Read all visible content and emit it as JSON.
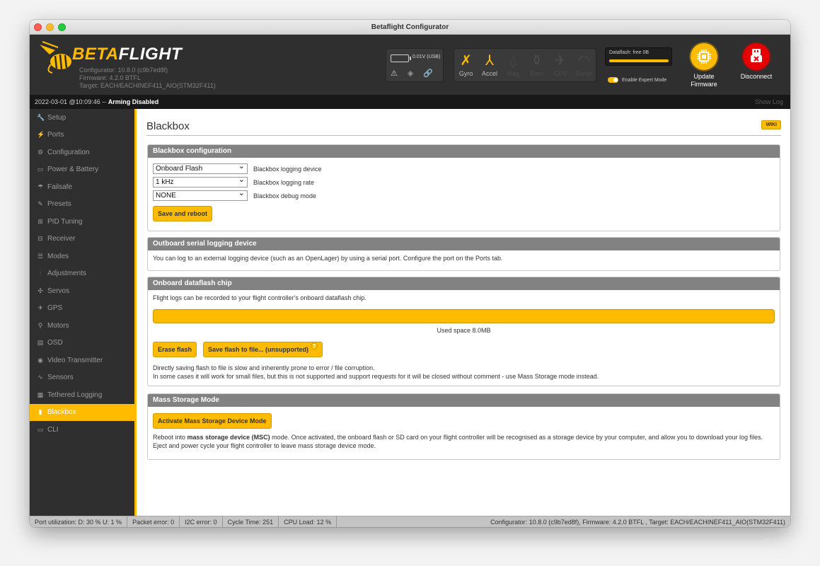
{
  "window": {
    "title": "Betaflight Configurator"
  },
  "header": {
    "brand_left": "BETA",
    "brand_right": "FLIGHT",
    "configurator": "Configurator: 10.8.0 (c9b7ed8f)",
    "firmware": "Firmware: 4.2.0 BTFL",
    "target": "Target: EACH/EACHINEF411_AIO(STM32F411)",
    "battery_text": "0.01V (USB)",
    "sensors": [
      {
        "label": "Gyro",
        "icon": "gyro-icon",
        "active": true
      },
      {
        "label": "Accel",
        "icon": "accel-icon",
        "active": true
      },
      {
        "label": "Mag",
        "icon": "mag-icon",
        "active": false
      },
      {
        "label": "Baro",
        "icon": "baro-icon",
        "active": false
      },
      {
        "label": "GPS",
        "icon": "gps-icon",
        "active": false
      },
      {
        "label": "Sonar",
        "icon": "sonar-icon",
        "active": false
      }
    ],
    "dataflash_label": "Dataflash: free 0B",
    "expert_mode_label": "Enable Expert Mode",
    "update_firmware_line1": "Update",
    "update_firmware_line2": "Firmware",
    "disconnect_label": "Disconnect"
  },
  "status": {
    "timestamp": "2022-03-01 @10:09:46 --",
    "arming": "Arming Disabled",
    "show_log": "Show Log"
  },
  "nav": [
    {
      "label": "Setup",
      "icon": "wrench-icon",
      "glyph": "🔧",
      "active": false
    },
    {
      "label": "Ports",
      "icon": "plug-icon",
      "glyph": "⚡",
      "active": false
    },
    {
      "label": "Configuration",
      "icon": "gear-icon",
      "glyph": "⚙",
      "active": false
    },
    {
      "label": "Power & Battery",
      "icon": "battery-icon",
      "glyph": "▭",
      "active": false
    },
    {
      "label": "Failsafe",
      "icon": "parachute-icon",
      "glyph": "☂",
      "active": false
    },
    {
      "label": "Presets",
      "icon": "wand-icon",
      "glyph": "✎",
      "active": false
    },
    {
      "label": "PID Tuning",
      "icon": "sitemap-icon",
      "glyph": "⊞",
      "active": false
    },
    {
      "label": "Receiver",
      "icon": "receiver-icon",
      "glyph": "⊟",
      "active": false
    },
    {
      "label": "Modes",
      "icon": "modes-icon",
      "glyph": "☰",
      "active": false
    },
    {
      "label": "Adjustments",
      "icon": "sliders-icon",
      "glyph": "⫶",
      "active": false
    },
    {
      "label": "Servos",
      "icon": "servo-icon",
      "glyph": "✣",
      "active": false
    },
    {
      "label": "GPS",
      "icon": "satellite-icon",
      "glyph": "✈",
      "active": false
    },
    {
      "label": "Motors",
      "icon": "motor-icon",
      "glyph": "⚲",
      "active": false
    },
    {
      "label": "OSD",
      "icon": "osd-icon",
      "glyph": "▤",
      "active": false
    },
    {
      "label": "Video Transmitter",
      "icon": "antenna-icon",
      "glyph": "◉",
      "active": false
    },
    {
      "label": "Sensors",
      "icon": "pulse-icon",
      "glyph": "∿",
      "active": false
    },
    {
      "label": "Tethered Logging",
      "icon": "log-icon",
      "glyph": "▦",
      "active": false
    },
    {
      "label": "Blackbox",
      "icon": "blackbox-icon",
      "glyph": "▮",
      "active": true
    },
    {
      "label": "CLI",
      "icon": "terminal-icon",
      "glyph": "▭",
      "active": false
    }
  ],
  "page": {
    "title": "Blackbox",
    "wiki": "WIKI",
    "config": {
      "header": "Blackbox configuration",
      "device_value": "Onboard Flash",
      "device_label": "Blackbox logging device",
      "rate_value": "1 kHz",
      "rate_label": "Blackbox logging rate",
      "debug_value": "NONE",
      "debug_label": "Blackbox debug mode",
      "save_button": "Save and reboot"
    },
    "outboard": {
      "header": "Outboard serial logging device",
      "text": "You can log to an external logging device (such as an OpenLager) by using a serial port. Configure the port on the Ports tab."
    },
    "dataflash": {
      "header": "Onboard dataflash chip",
      "text": "Flight logs can be recorded to your flight controller's onboard dataflash chip.",
      "used_fraction": 1.0,
      "used_text": "Used space 8.0MB",
      "erase_button": "Erase flash",
      "save_button": "Save flash to file... (unsupported)",
      "note1": "Directly saving flash to file is slow and inherently prone to error / file corruption.",
      "note2": "In some cases it will work for small files, but this is not supported and support requests for it will be closed without comment - use Mass Storage mode instead."
    },
    "msc": {
      "header": "Mass Storage Mode",
      "button": "Activate Mass Storage Device Mode",
      "text_pre": "Reboot into ",
      "text_bold": "mass storage device (MSC)",
      "text_post": " mode. Once activated, the onboard flash or SD card on your flight controller will be recognised as a storage device by your computer, and allow you to download your log files. Eject and power cycle your flight controller to leave mass storage device mode."
    }
  },
  "footer": {
    "port_util": "Port utilization: D: 30 % U: 1 %",
    "packet_error": "Packet error: 0",
    "i2c_error": "I2C error: 0",
    "cycle_time": "Cycle Time: 251",
    "cpu_load": "CPU Load: 12 %",
    "version": "Configurator: 10.8.0 (c9b7ed8f), Firmware: 4.2.0 BTFL , Target: EACH/EACHINEF411_AIO(STM32F411)"
  }
}
